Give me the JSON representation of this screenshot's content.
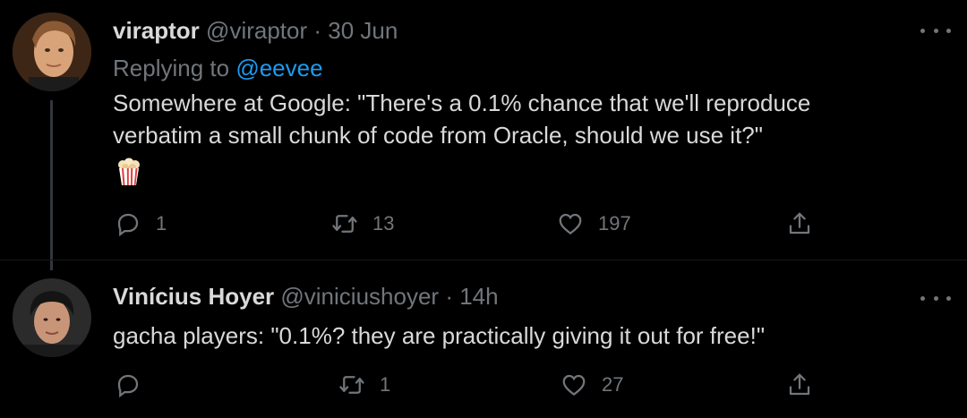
{
  "tweets": [
    {
      "author_name": "viraptor",
      "handle": "@viraptor",
      "separator": "·",
      "time": "30 Jun",
      "replying_prefix": "Replying to",
      "replying_to": "@eevee",
      "text": "Somewhere at Google: \"There's a 0.1% chance that we'll reproduce\nverbatim a small chunk of code from Oracle, should we use it?\"",
      "emoji": "popcorn-icon",
      "replies": "1",
      "retweets": "13",
      "likes": "197"
    },
    {
      "author_name": "Vinícius Hoyer",
      "handle": "@viniciushoyer",
      "separator": "·",
      "time": "14h",
      "text": "gacha players: \"0.1%? they are practically giving it out for free!\"",
      "replies": "",
      "retweets": "1",
      "likes": "27"
    }
  ],
  "colors": {
    "background": "#000000",
    "text": "#d9d9d9",
    "secondary": "#71767b",
    "link": "#1d9bf0"
  }
}
